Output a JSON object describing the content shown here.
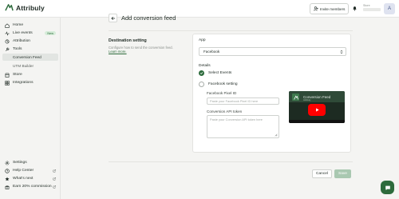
{
  "app": {
    "name": "Attribuly"
  },
  "header": {
    "invite_label": "Invite members",
    "store_label": "Store",
    "avatar_initial": "A"
  },
  "sidebar": {
    "items": [
      {
        "label": "Home",
        "icon": "home-icon"
      },
      {
        "label": "Live events",
        "icon": "pulse-icon",
        "badge": "New"
      },
      {
        "label": "Attribution",
        "icon": "attribution-icon"
      },
      {
        "label": "Tools",
        "icon": "tools-icon"
      },
      {
        "label": "Conversion Feed",
        "active": true
      },
      {
        "label": "UTM Builder"
      },
      {
        "label": "Store",
        "icon": "store-icon"
      },
      {
        "label": "Integrations",
        "icon": "integrations-icon"
      }
    ],
    "bottom": [
      {
        "label": "Settings",
        "icon": "gear-icon"
      },
      {
        "label": "Help Center",
        "icon": "help-icon"
      },
      {
        "label": "What's next",
        "icon": "star-icon"
      },
      {
        "label": "Earn 20% commission",
        "icon": "gift-icon"
      }
    ]
  },
  "page": {
    "title": "Add conversion feed"
  },
  "destination": {
    "title": "Destination setting",
    "desc": "Configure how to send the conversion feed.",
    "learn_more": "Learn more."
  },
  "form": {
    "app_label": "App",
    "app_value": "Facebook",
    "details_label": "Details",
    "option_select_events": "Select Events",
    "option_facebook_setting": "Facebook setting",
    "pixel_label": "Facebook Pixel ID",
    "pixel_placeholder": "Paste your Facebook Pixel ID here",
    "token_label": "Conversion API token",
    "token_placeholder": "Paste your Conversion API token here"
  },
  "video": {
    "title": "Conversion Feed",
    "subtitle": "Attribuly"
  },
  "footer": {
    "cancel": "Cancel",
    "save": "Save"
  },
  "colors": {
    "brand": "#2d6b3c",
    "save_disabled": "#a9c8b1",
    "youtube_red": "#ff0000"
  }
}
